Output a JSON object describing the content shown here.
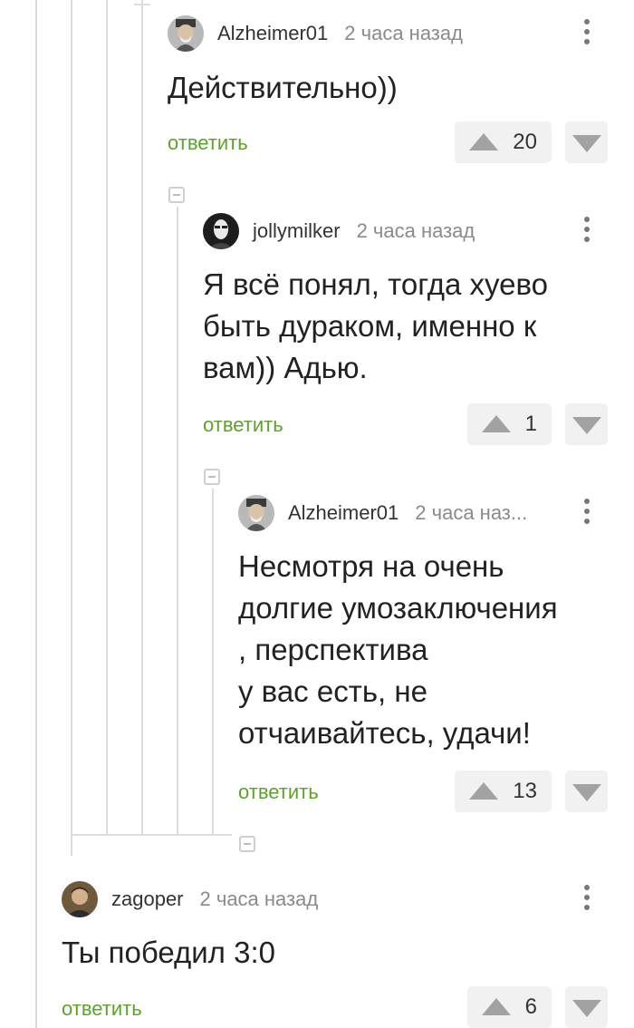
{
  "comments": [
    {
      "author": "Alzheimer01",
      "time": "2 часа назад",
      "text": "Действительно))",
      "reply": "ответить",
      "votes": "20",
      "avatar": "avatar-old-man-icon"
    },
    {
      "author": "jollymilker",
      "time": "2 часа назад",
      "text": "Я всё понял, тогда хуево\nбыть дураком, именно к\nвам)) Адью.",
      "reply": "ответить",
      "votes": "1",
      "avatar": "avatar-dark-portrait-icon"
    },
    {
      "author": "Alzheimer01",
      "time": "2 часа наз...",
      "text": "Несмотря на очень\nдолгие умозаключения\n, перспектива\nу вас есть, не\nотчаивайтесь, удачи!",
      "reply": "ответить",
      "votes": "13",
      "avatar": "avatar-old-man-icon"
    },
    {
      "author": "zagoper",
      "time": "2 часа назад",
      "text": "Ты победил 3:0",
      "reply": "ответить",
      "votes": "6",
      "avatar": "avatar-man-portrait-icon"
    }
  ],
  "colors": {
    "reply": "#5fa12d",
    "thread_line": "#dcdcdc",
    "vote_bg": "#f1f1f1",
    "vote_arrow": "#a2a2a2"
  }
}
